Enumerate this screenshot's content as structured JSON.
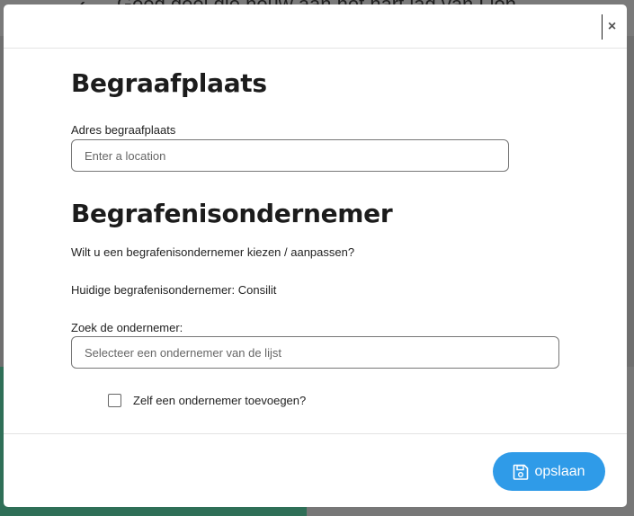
{
  "background": {
    "title": "Goed doel die nouw aan het hart lag van Lion",
    "back_icon": "chevron-left-icon"
  },
  "modal": {
    "close_label": "×",
    "cemetery": {
      "heading": "Begraafplaats",
      "address_label": "Adres begraafplaats",
      "address_placeholder": "Enter a location",
      "address_value": ""
    },
    "undertaker": {
      "heading": "Begrafenisondernemer",
      "question": "Wilt u een begrafenisondernemer kiezen / aanpassen?",
      "current": "Huidige begrafenisondernemer: Consilit",
      "search_label": "Zoek de ondernemer:",
      "search_placeholder": "Selecteer een ondernemer van de lijst",
      "add_self_label": "Zelf een ondernemer toevoegen?",
      "add_self_checked": false
    },
    "footer": {
      "save_label": "opslaan",
      "save_icon": "floppy-disk-icon"
    }
  },
  "colors": {
    "accent": "#2f9be8",
    "backdrop_green": "#2f6f57"
  }
}
